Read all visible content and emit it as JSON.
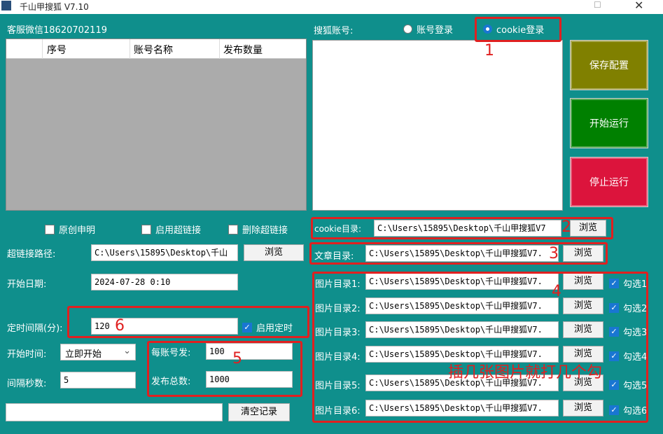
{
  "window": {
    "title": "千山甲搜狐 V7.10"
  },
  "left": {
    "service_label": "客服微信18620702119",
    "table": {
      "columns": [
        "",
        "序号",
        "账号名称",
        "发布数量"
      ]
    },
    "checks": [
      {
        "label": "原创申明",
        "checked": false
      },
      {
        "label": "启用超链接",
        "checked": false
      },
      {
        "label": "删除超链接",
        "checked": false
      }
    ],
    "link_path": {
      "label": "超链接路径:",
      "value": "C:\\Users\\15895\\Desktop\\千山",
      "browse": "浏览"
    },
    "start_date": {
      "label": "开始日期:",
      "value": "2024-07-28  0:10"
    },
    "interval": {
      "label": "定时间隔(分):",
      "value": "120",
      "enable_label": "启用定时",
      "enable_checked": true
    },
    "start_time": {
      "label": "开始时间:",
      "value": "立即开始"
    },
    "gap_seconds": {
      "label": "间隔秒数:",
      "value": "5"
    },
    "per_account": {
      "label": "每账号发:",
      "value": "100"
    },
    "total": {
      "label": "发布总数:",
      "value": "1000"
    },
    "log_value": "",
    "clear_button": "清空记录"
  },
  "right": {
    "account_label": "搜狐账号:",
    "radio_account": "账号登录",
    "radio_cookie": "cookie登录",
    "cookie_dir": {
      "label": "cookie目录:",
      "value": "C:\\Users\\15895\\Desktop\\千山甲搜狐V7",
      "browse": "浏览"
    },
    "article_dir": {
      "label": "文章目录:",
      "value": "C:\\Users\\15895\\Desktop\\千山甲搜狐V7.",
      "browse": "浏览"
    },
    "image_dirs": [
      {
        "label": "图片目录1:",
        "value": "C:\\Users\\15895\\Desktop\\千山甲搜狐V7.",
        "browse": "浏览",
        "check": "勾选1"
      },
      {
        "label": "图片目录2:",
        "value": "C:\\Users\\15895\\Desktop\\千山甲搜狐V7.",
        "browse": "浏览",
        "check": "勾选2"
      },
      {
        "label": "图片目录3:",
        "value": "C:\\Users\\15895\\Desktop\\千山甲搜狐V7.",
        "browse": "浏览",
        "check": "勾选3"
      },
      {
        "label": "图片目录4:",
        "value": "C:\\Users\\15895\\Desktop\\千山甲搜狐V7.",
        "browse": "浏览",
        "check": "勾选4"
      },
      {
        "label": "图片目录5:",
        "value": "C:\\Users\\15895\\Desktop\\千山甲搜狐V7.",
        "browse": "浏览",
        "check": "勾选5"
      },
      {
        "label": "图片目录6:",
        "value": "C:\\Users\\15895\\Desktop\\千山甲搜狐V7.",
        "browse": "浏览",
        "check": "勾选6"
      }
    ],
    "buttons": {
      "save": "保存配置",
      "start": "开始运行",
      "stop": "停止运行"
    },
    "button_colors": {
      "save": "#808000",
      "start": "#008000",
      "stop": "#dc143c"
    }
  },
  "annotations": {
    "numbers": [
      "1",
      "2",
      "3",
      "4",
      "5",
      "6"
    ],
    "image_note": "插几张图片就打几个勾",
    "color": "#e02020"
  }
}
